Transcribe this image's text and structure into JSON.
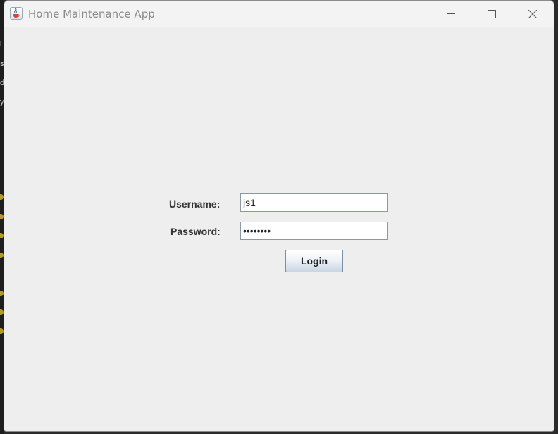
{
  "window": {
    "title": "Home Maintenance App",
    "icon": "java-cup-icon"
  },
  "controls": {
    "minimize": "minimize-icon",
    "maximize": "maximize-icon",
    "close": "close-icon"
  },
  "login": {
    "username_label": "Username:",
    "username_value": "js1",
    "password_label": "Password:",
    "password_masked": "••••••••",
    "login_button": "Login"
  },
  "colors": {
    "background": "#eeeeee",
    "titlebar": "#f3f3f3",
    "field_border": "#8a98a8",
    "button_border": "#7b8ea5"
  }
}
